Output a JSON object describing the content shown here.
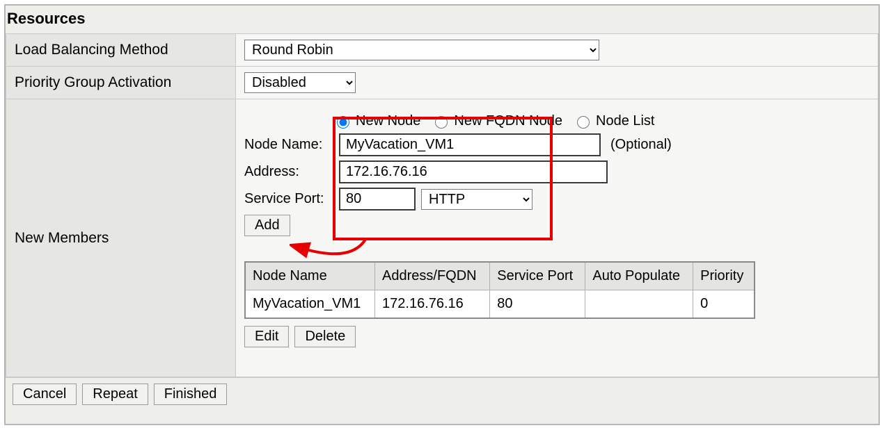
{
  "section_title": "Resources",
  "rows": {
    "lb_method": {
      "label": "Load Balancing Method",
      "value": "Round Robin"
    },
    "priority_group": {
      "label": "Priority Group Activation",
      "value": "Disabled"
    },
    "new_members": {
      "label": "New Members"
    }
  },
  "node_type": {
    "options": {
      "new_node": "New Node",
      "new_fqdn": "New FQDN Node",
      "node_list": "Node List"
    },
    "selected": "new_node"
  },
  "fields": {
    "node_name": {
      "label": "Node Name:",
      "value": "MyVacation_VM1",
      "optional": "(Optional)"
    },
    "address": {
      "label": "Address:",
      "value": "172.16.76.16"
    },
    "service_port": {
      "label": "Service Port:",
      "value": "80",
      "proto": "HTTP"
    }
  },
  "buttons": {
    "add": "Add",
    "edit": "Edit",
    "delete": "Delete",
    "cancel": "Cancel",
    "repeat": "Repeat",
    "finished": "Finished"
  },
  "members_table": {
    "headers": [
      "Node Name",
      "Address/FQDN",
      "Service Port",
      "Auto Populate",
      "Priority"
    ],
    "rows": [
      {
        "node_name": "MyVacation_VM1",
        "address": "172.16.76.16",
        "port": "80",
        "auto": "",
        "priority": "0"
      }
    ]
  },
  "annotation": {
    "highlight": "Red box highlighting the New Node fields with an arrow pointing to Add"
  }
}
